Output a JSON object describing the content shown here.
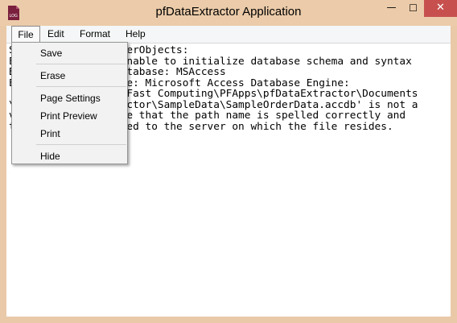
{
  "window": {
    "title": "pfDataExtractor Application",
    "app_icon": "log-file-icon",
    "app_icon_text": "LOG",
    "minimize_glyph": "—",
    "maximize_glyph": "☐",
    "close_glyph": "✕"
  },
  "menubar": {
    "file": "File",
    "edit": "Edit",
    "format": "Format",
    "help": "Help"
  },
  "file_menu": {
    "save": "Save",
    "erase": "Erase",
    "page_settings": "Page Settings",
    "print_preview": "Print Preview",
    "print": "Print",
    "hide": "Hide"
  },
  "log": {
    "lines": [
      "S                  erObjects:",
      "E                 Unable to initialize database schema and syntax",
      "B                database: MSAccess",
      "E                rce: Microsoft Access Database Engine:",
      "                 roFast Computing\\PFApps\\pfDataExtractor\\Documents",
      "\\                ractor\\SampleData\\SampleOrderData.accdb' is not a",
      "v                ure that the path name is spelled correctly and",
      "t                cted to the server on which the file resides."
    ]
  },
  "colors": {
    "titlebar": "#ebcba9",
    "close_button": "#c7504f",
    "menu_background": "#f2f2f2"
  }
}
